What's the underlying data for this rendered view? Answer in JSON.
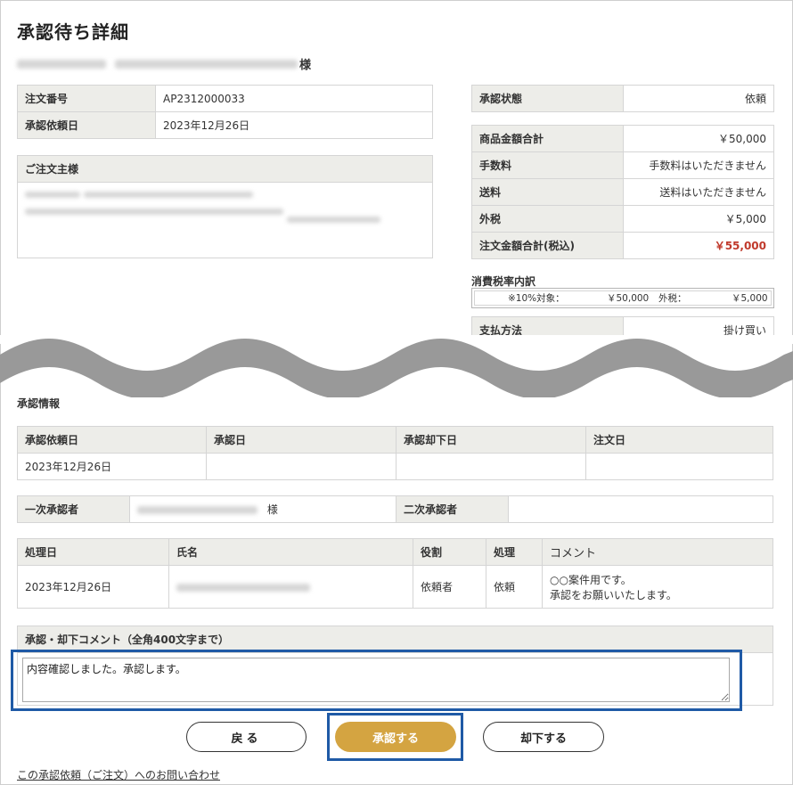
{
  "page": {
    "title": "承認待ち詳細"
  },
  "customer": {
    "suffix": "様"
  },
  "order": {
    "rows": [
      {
        "label": "注文番号",
        "value": "AP2312000033"
      },
      {
        "label": "承認依頼日",
        "value": "2023年12月26日"
      }
    ],
    "orderer_header": "ご注文主様"
  },
  "status": {
    "label": "承認状態",
    "value": "依頼"
  },
  "amounts": [
    {
      "label": "商品金額合計",
      "value": "￥50,000"
    },
    {
      "label": "手数料",
      "value": "手数料はいただきません"
    },
    {
      "label": "送料",
      "value": "送料はいただきません"
    },
    {
      "label": "外税",
      "value": "￥5,000"
    },
    {
      "label": "注文金額合計(税込)",
      "value": "￥55,000"
    }
  ],
  "tax_breakdown": {
    "title": "消費税率内訳",
    "target_label": "※10%対象：",
    "target_value": "￥50,000",
    "tax_label": "外税：",
    "tax_value": "￥5,000"
  },
  "payment": {
    "label": "支払方法",
    "value": "掛け買い"
  },
  "approval_info": {
    "title": "承認情報",
    "dates_headers": [
      "承認依頼日",
      "承認日",
      "承認却下日",
      "注文日"
    ],
    "dates_values": [
      "2023年12月26日",
      "",
      "",
      ""
    ],
    "first_approver_label": "一次承認者",
    "first_approver_suffix": "様",
    "second_approver_label": "二次承認者",
    "history_headers": [
      "処理日",
      "氏名",
      "役割",
      "処理",
      "コメント"
    ],
    "history_rows": [
      {
        "date": "2023年12月26日",
        "role": "依頼者",
        "action": "依頼",
        "comment_line1": "○○案件用です。",
        "comment_line2": "承認をお願いいたします。"
      }
    ]
  },
  "comment": {
    "header": "承認・却下コメント（全角400文字まで）",
    "value": "内容確認しました。承認します。"
  },
  "buttons": {
    "back": "戻る",
    "approve": "承認する",
    "reject": "却下する"
  },
  "contact_link": "この承認依頼（ご注文）へのお問い合わせ",
  "colors": {
    "accent": "#d4a441",
    "highlight": "#1f5aa6",
    "total_red": "#c0392b",
    "label_bg": "#edede9"
  }
}
